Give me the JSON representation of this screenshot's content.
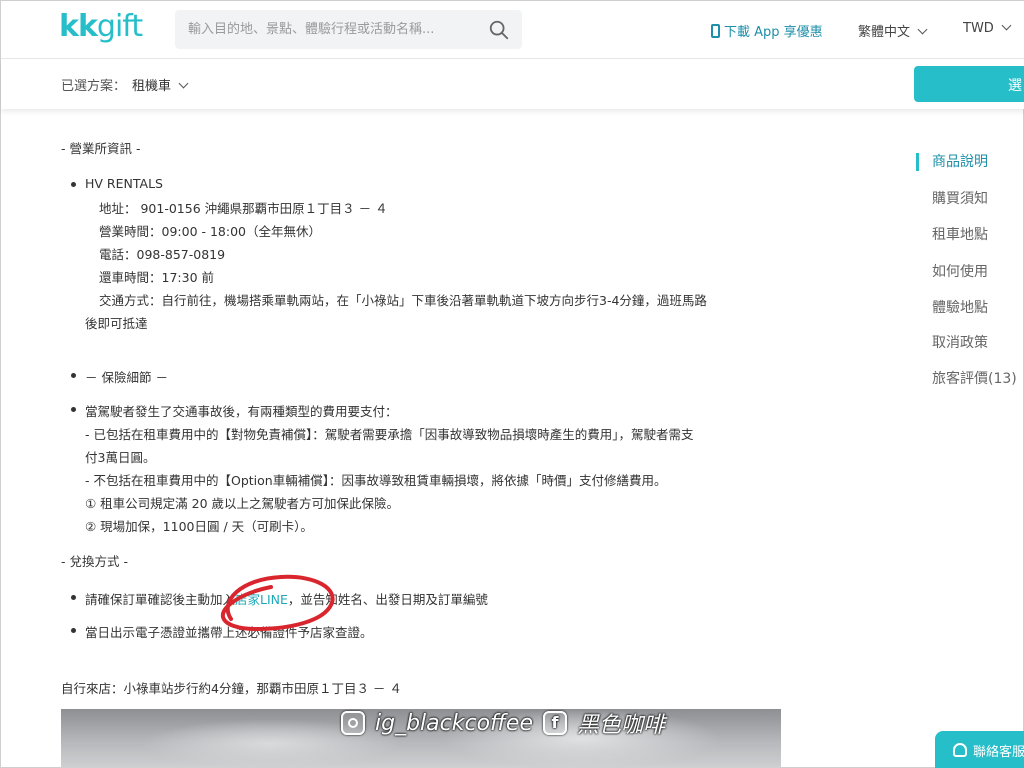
{
  "header": {
    "logo_kk": "kk",
    "logo_gift": "gift",
    "search_placeholder": "輸入目的地、景點、體驗行程或活動名稱...",
    "download_app": "下載 App 享優惠",
    "language": "繁體中文",
    "currency": "TWD"
  },
  "subbar": {
    "plan_label": "已選方案：",
    "plan_value": "租機車",
    "select_button": "選"
  },
  "content": {
    "office_heading": "- 營業所資訊 -",
    "office_name": "HV RENTALS",
    "address": "地址： 901-0156 沖繩県那覇市田原１丁目３ － ４",
    "hours": "營業時間：09:00 - 18:00（全年無休）",
    "phone": "電話：098-857-0819",
    "return_time": "還車時間：17:30 前",
    "transport_1": "交通方式：自行前往，機場搭乘單軌兩站，在「小祿站」下車後沿著單軌軌道下坡方向步行3-4分鐘，過班馬路",
    "transport_2": "後即可抵達",
    "insurance_heading": "－ 保險細節 －",
    "insurance_intro": "當駕駛者發生了交通事故後，有兩種類型的費用要支付：",
    "insurance_a1": "- 已包括在租車費用中的【對物免責補償】：駕駛者需要承擔「因事故導致物品損壞時產生的費用」，駕駛者需支",
    "insurance_a2": "付3萬日圓。",
    "insurance_b": "- 不包括在租車費用中的【Option車輛補償】：因事故導致租賃車輛損壞，將依據「時價」支付修繕費用。",
    "insurance_c1": "① 租車公司規定滿 20 歲以上之駕駛者方可加保此保險。",
    "insurance_c2": "② 現場加保，1100日圓 / 天（可刷卡）。",
    "redeem_heading": "- 兌換方式 -",
    "redeem_1_pre": "請確保訂單確認後主動加入",
    "redeem_1_link": "店家LINE",
    "redeem_1_post": "，並告知姓名、出發日期及訂單編號",
    "redeem_2": "當日出示電子憑證並攜帶上述必備證件予店家查證。",
    "self_visit": "自行來店：小祿車站步行約4分鐘，那覇市田原１丁目３ － ４"
  },
  "sidenav": {
    "items": [
      "商品說明",
      "購買須知",
      "租車地點",
      "如何使用",
      "體驗地點",
      "取消政策",
      "旅客評價(13)"
    ]
  },
  "watermark": {
    "instagram": "ig_blackcoffee",
    "facebook": "黑色咖啡"
  },
  "support": {
    "label": "聯絡客服"
  },
  "colors": {
    "brand": "#26bec9",
    "link": "#1fa9b9",
    "annotation": "#d9262e"
  }
}
